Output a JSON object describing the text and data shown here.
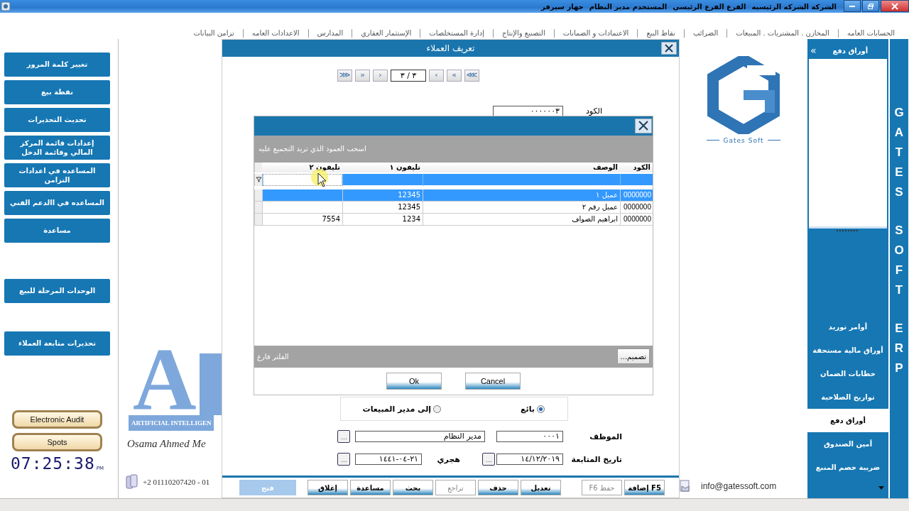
{
  "title_bar": {
    "info": [
      "الشركة الشركه الرئيسيه",
      "الفرع الفرع الرئيسي",
      "المستخدم مدير النظام",
      "جهاز سيرفر"
    ]
  },
  "menu": [
    "الحسابات العامه",
    "المخازن . المشتريات . المبيعات",
    "الضرائب",
    "نقاط البيع",
    "الاعتمادات و الضمانات",
    "التصنيع والإنتاج",
    "إدارة المستخلصات",
    "الإستثمار العقاري",
    "المدارس",
    "الاعدادات العامه",
    "تزامن البيانات"
  ],
  "side_groups": [
    {
      "buttons": [
        "تغيير كلمة المرور",
        "نقطة بيع",
        "تحديث التحذيرات",
        "إعدادات قائمة المركز المالي وقائمة الدخل",
        "المساعده في اعدادات التزامن",
        "المساعده في االدعم الفني",
        "مساعدة"
      ]
    },
    {
      "buttons": [
        "الوحدات المرحلة للبيع"
      ]
    },
    {
      "buttons": [
        "تحذيرات متابعة العملاء"
      ]
    }
  ],
  "audit_buttons": [
    "Electronic Audit",
    "Spots"
  ],
  "clock": {
    "time": "07:25:38",
    "period": "PM"
  },
  "ai_panel": {
    "letter": "A",
    "caption": "ARTIFICIAL INTELLIGEN",
    "signature": "Osama Ahmed Me",
    "phone": "+2 01110207420 - 01"
  },
  "dialog": {
    "title": "تعريف العملاء",
    "nav_before": [
      "⋙",
      "»",
      "›"
    ],
    "position": "٣ / ٣",
    "nav_after": [
      "‹",
      "«",
      "⋘"
    ],
    "code": {
      "label": "الكود",
      "value": "٠٠٠٠٠٠٣"
    },
    "popup": {
      "group_hint": "اسحب العمود الذي تريد التجميع عليه",
      "columns": [
        "الكود",
        "الوصف",
        "تليفون ١",
        "تليفون ٢"
      ],
      "rows": [
        {
          "cells": [
            "0000000",
            "عميل ١",
            "12345",
            null
          ],
          "selected": true
        },
        {
          "cells": [
            "0000000",
            "عميل رقم ٢",
            "12345",
            null
          ],
          "selected": false
        },
        {
          "cells": [
            "0000000",
            "ابراهيم الصواف",
            "1234",
            "7554"
          ],
          "selected": false
        }
      ],
      "filter_status": "الفلتر فارغ",
      "design_button": "تصميم...",
      "ok": "Ok",
      "cancel": "Cancel"
    },
    "radios": [
      {
        "label": "بائع",
        "selected": true
      },
      {
        "label": "إلى مدير المبيعات",
        "selected": false
      }
    ],
    "employee": {
      "label": "الموظف",
      "code": "٠٠٠١",
      "name": "مدير النظام"
    },
    "follow_up": {
      "label": "تاريخ المتابعة",
      "date": "١٤/١٢/٢٠١٩",
      "hijri_label": "هجري",
      "hijri": "٢١-٠٤-١٤٤١"
    },
    "toolbar": {
      "file_buttons": [
        {
          "label": "F5 إضافة",
          "disabled": false
        },
        {
          "label": "حفظ F6",
          "disabled": true
        }
      ],
      "edit_buttons": [
        {
          "label": "تعديل",
          "disabled": false
        },
        {
          "label": "حذف",
          "disabled": false
        },
        {
          "label": "تراجع",
          "disabled": true
        },
        {
          "label": "بحث",
          "disabled": false
        },
        {
          "label": "مساعدة",
          "disabled": false
        },
        {
          "label": "إغلاق",
          "disabled": false
        }
      ],
      "open_button": {
        "label": "فتح",
        "disabled": true
      }
    }
  },
  "gates_panel": {
    "caption": "Gates Soft",
    "email": "info@gatessoft.com"
  },
  "nav": {
    "chevron": "»",
    "title": "أوراق دفع",
    "items": [
      {
        "label": "أوامر توريد",
        "selected": false
      },
      {
        "label": "أوراق مالية مستحقة",
        "selected": false
      },
      {
        "label": "خطابات الضمان",
        "selected": false
      },
      {
        "label": "تواريخ الصلاحية",
        "selected": false
      },
      {
        "label": "أوراق دفع",
        "selected": true
      },
      {
        "label": "أمين الصندوق",
        "selected": false
      },
      {
        "label": "ضريبة خصم المنبع",
        "selected": false
      }
    ]
  },
  "brand": [
    "GATES",
    "SOFT",
    "ERP"
  ]
}
